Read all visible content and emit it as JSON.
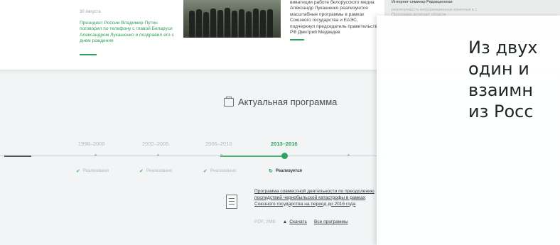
{
  "news": {
    "date": "30 Августа",
    "left_text": "Президент России Владимир Путин поговорил по телефону с главой Беларуси Александром Лукашенко и поздравил его с днем рождения",
    "middle_text": "Александр Лукашенко реализуются масштабные программы в рамках Союзного государства и ЕАЭС, подчеркнул председатель правительства РФ Дмитрий Медведев",
    "middle_text_top": "виватиции работе белорусского медиа"
  },
  "right_strip": {
    "header": "Интернет-семинар Редакционная",
    "text": "реализуемость информационных конечных в 1 Программа включает области"
  },
  "program": {
    "title": "Актуальная программа",
    "periods": [
      "1998–2000",
      "2002–2005",
      "2006–2010",
      "2013–2016"
    ],
    "statuses": [
      "Реализовано",
      "Реализовано",
      "Реализовано",
      "Реализуется"
    ],
    "document_title": "Программа совместной деятельности по преодолению последствий чернобыльской катастрофы в рамках Союзного государства на период до 2016 года",
    "file_info": "PDF, 2MB",
    "download_label": "Скачать",
    "all_programs_label": "Все программы"
  },
  "overlay": {
    "lines": [
      "Из двух",
      "один и",
      "взаимн",
      "из Росс"
    ]
  }
}
